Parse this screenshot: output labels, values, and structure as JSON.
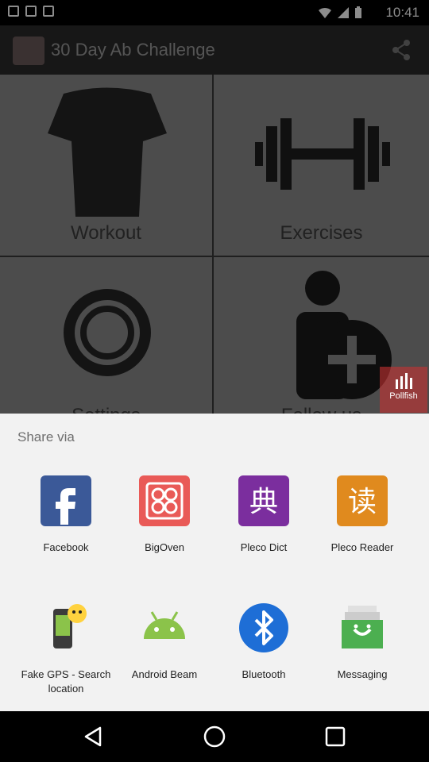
{
  "status_bar": {
    "time": "10:41"
  },
  "app_bar": {
    "title": "30 Day Ab Challenge"
  },
  "grid": {
    "tiles": [
      {
        "label": "Workout"
      },
      {
        "label": "Exercises"
      },
      {
        "label": "Settings"
      },
      {
        "label": "Follow us"
      }
    ]
  },
  "ad": {
    "label": "Pollfish"
  },
  "share_sheet": {
    "header": "Share via",
    "apps": [
      {
        "label": "Facebook",
        "icon": "facebook-icon",
        "color": "#3b5998"
      },
      {
        "label": "BigOven",
        "icon": "bigoven-icon",
        "color": "#e95a57"
      },
      {
        "label": "Pleco Dict",
        "icon": "pleco-dict-icon",
        "color": "#7b2e9e"
      },
      {
        "label": "Pleco Reader",
        "icon": "pleco-reader-icon",
        "color": "#e08a1e"
      },
      {
        "label": "Fake GPS - Search location",
        "icon": "fake-gps-icon",
        "color": "#5a8f2f"
      },
      {
        "label": "Android Beam",
        "icon": "android-beam-icon",
        "color": "#8bc34a"
      },
      {
        "label": "Bluetooth",
        "icon": "bluetooth-icon",
        "color": "#1e6ed6"
      },
      {
        "label": "Messaging",
        "icon": "messaging-icon",
        "color": "#4caf50"
      }
    ]
  },
  "nav": {
    "back": "back-icon",
    "home": "home-icon",
    "recents": "recents-icon"
  }
}
